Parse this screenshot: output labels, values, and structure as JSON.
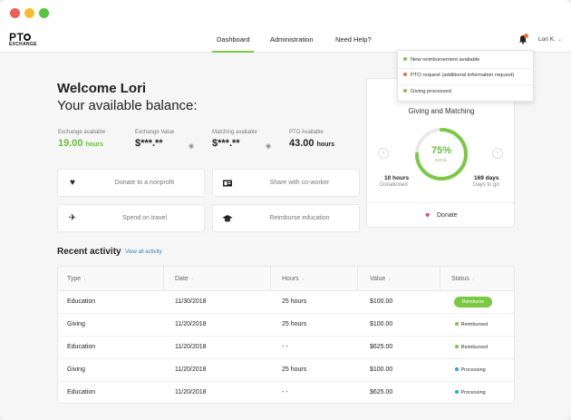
{
  "window": {
    "traffic_lights": [
      "#f25e57",
      "#f6be2f",
      "#54c541"
    ]
  },
  "nav": {
    "logo_prefix": "PT",
    "logo_sub": "EXCHANGE",
    "links": [
      "Dashboard",
      "Administration",
      "Need Help?"
    ],
    "active": "Dashboard",
    "user": "Lori K."
  },
  "welcome": {
    "greeting": "Welcome Lori",
    "subtitle": "Your available balance:"
  },
  "stats": [
    {
      "label": "Exchange available",
      "value": "19.00",
      "unit": "hours",
      "color": "#6abf3b"
    },
    {
      "label": "Exchange Value",
      "value": "$***.**",
      "unit": "",
      "hidden": true
    },
    {
      "label": "Matching available",
      "value": "$***.**",
      "unit": "",
      "hidden": true
    },
    {
      "label": "PTO Available",
      "value": "43.00",
      "unit": "hours"
    }
  ],
  "actions": [
    {
      "label": "Donate to a nonprofit",
      "icon": "heart-icon"
    },
    {
      "label": "Share with co-worker",
      "icon": "id-card-icon"
    },
    {
      "label": "Spend on travel",
      "icon": "plane-icon"
    },
    {
      "label": "Reimburse education",
      "icon": "graduation-cap-icon"
    }
  ],
  "giving": {
    "title": "Giving and Matching",
    "progress_pct": 75,
    "percent_label": "75%",
    "goal_label": "GOAL",
    "left_value": "10 hours",
    "left_label": "Donationed",
    "right_value": "169 days",
    "right_label": "Days to go",
    "donate_label": "Donate",
    "accent": "#7ac943"
  },
  "notifications": [
    {
      "text": "New reimbursement available",
      "color": "#7ac943"
    },
    {
      "text": "PTO request (additional information request)",
      "color": "#e8703a"
    },
    {
      "text": "Giving processed",
      "color": "#7ac943"
    }
  ],
  "recent": {
    "title": "Recent activity",
    "view_all": "View all activity",
    "columns": [
      "Type",
      "Date",
      "Hours",
      "Value",
      "Status"
    ],
    "rows": [
      {
        "type": "Education",
        "date": "11/30/2018",
        "hours": "25 hours",
        "value": "$100.00",
        "status": "Reimburse",
        "status_kind": "pill"
      },
      {
        "type": "Giving",
        "date": "11/20/2018",
        "hours": "25 hours",
        "value": "$100.00",
        "status": "Reimbursed",
        "status_kind": "green"
      },
      {
        "type": "Education",
        "date": "11/20/2018",
        "hours": "- -",
        "value": "$625.00",
        "status": "Reimbursed",
        "status_kind": "green"
      },
      {
        "type": "Giving",
        "date": "11/20/2018",
        "hours": "25 hours",
        "value": "$100.00",
        "status": "Processing",
        "status_kind": "blue"
      },
      {
        "type": "Education",
        "date": "11/20/2018",
        "hours": "- -",
        "value": "$625.00",
        "status": "Processing",
        "status_kind": "blue"
      }
    ],
    "status_colors": {
      "green": "#7ac943",
      "blue": "#2fa7e0",
      "pill": "#7ac943"
    }
  }
}
